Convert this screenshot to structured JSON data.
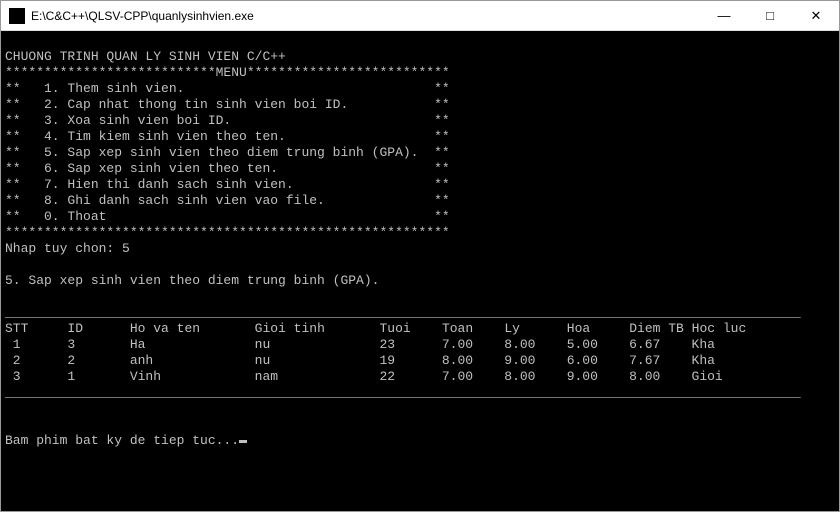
{
  "window": {
    "title": "E:\\C&C++\\QLSV-CPP\\quanlysinhvien.exe"
  },
  "program": {
    "header": "CHUONG TRINH QUAN LY SINH VIEN C/C++",
    "menu_label": "MENU",
    "star_row": "**************************************************",
    "menu_row_star": "***************************MENU**************************",
    "items": [
      "**   1. Them sinh vien.                                **",
      "**   2. Cap nhat thong tin sinh vien boi ID.           **",
      "**   3. Xoa sinh vien boi ID.                          **",
      "**   4. Tim kiem sinh vien theo ten.                   **",
      "**   5. Sap xep sinh vien theo diem trung binh (GPA).  **",
      "**   6. Sap xep sinh vien theo ten.                    **",
      "**   7. Hien thi danh sach sinh vien.                  **",
      "**   8. Ghi danh sach sinh vien vao file.              **",
      "**   0. Thoat                                          **"
    ],
    "footer_stars": "*********************************************************",
    "prompt": "Nhap tuy chon: 5",
    "selected_action": "5. Sap xep sinh vien theo diem trung binh (GPA)."
  },
  "table": {
    "hr": "______________________________________________________________________________________________________",
    "headers": {
      "stt": "STT",
      "id": "ID",
      "name": "Ho va ten",
      "gender": "Gioi tinh",
      "age": "Tuoi",
      "toan": "Toan",
      "ly": "Ly",
      "hoa": "Hoa",
      "gpa": "Diem TB",
      "rank": "Hoc luc"
    },
    "rows": [
      {
        "stt": " 1",
        "id": "3",
        "name": "Ha",
        "gender": "nu",
        "age": "23",
        "toan": "7.00",
        "ly": "8.00",
        "hoa": "5.00",
        "gpa": "6.67",
        "rank": "Kha"
      },
      {
        "stt": " 2",
        "id": "2",
        "name": "anh",
        "gender": "nu",
        "age": "19",
        "toan": "8.00",
        "ly": "9.00",
        "hoa": "6.00",
        "gpa": "7.67",
        "rank": "Kha"
      },
      {
        "stt": " 3",
        "id": "1",
        "name": "Vinh",
        "gender": "nam",
        "age": "22",
        "toan": "7.00",
        "ly": "8.00",
        "hoa": "9.00",
        "gpa": "8.00",
        "rank": "Gioi"
      }
    ]
  },
  "continue_prompt": "Bam phim bat ky de tiep tuc..."
}
